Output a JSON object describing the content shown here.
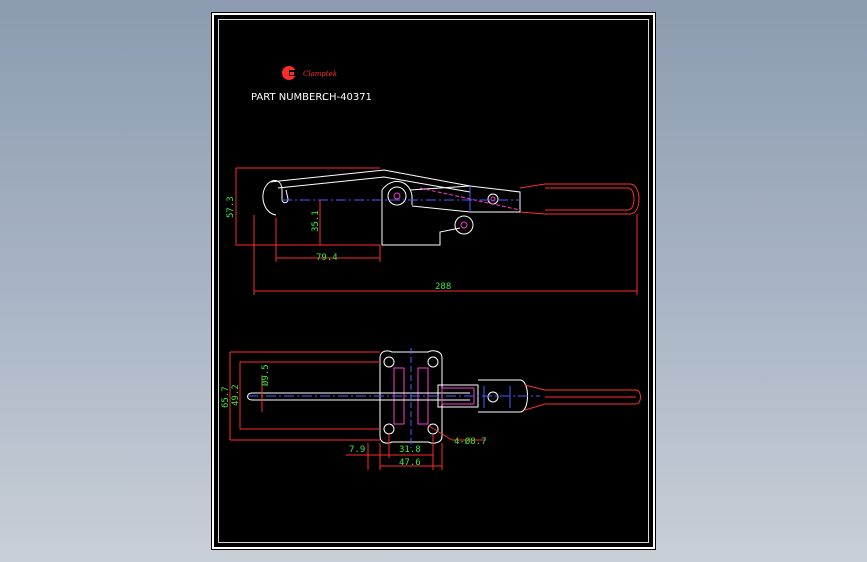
{
  "brand": {
    "logo_letter": "C",
    "name": "Clamptek"
  },
  "header": {
    "part_label": "PART NUMBER:",
    "part_number": "CH-40371"
  },
  "dimensions": {
    "side_height": "57.3",
    "side_pin_height": "35.1",
    "side_hook_offset": "79.4",
    "overall_length": "288",
    "top_width": "65.7",
    "top_inner_width": "49.2",
    "pin_diameter": "Ø9.5",
    "base_offset": "7.9",
    "hole_spacing": "31.8",
    "base_length": "47.6",
    "mount_holes": "4-Ø8.7"
  },
  "colors": {
    "frame": "#000000",
    "outline": "#ffffff",
    "dimension": "#ff2a2a",
    "dimension_text": "#3ee63e",
    "centerline": "#4a5cff",
    "accent": "#ff3ad0",
    "handle": "#ff3030"
  }
}
